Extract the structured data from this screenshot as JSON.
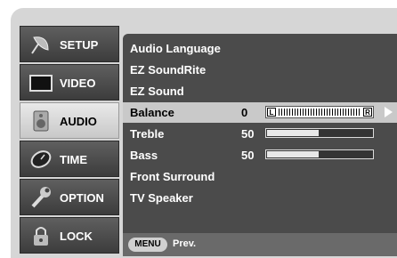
{
  "nav": [
    {
      "label": "SETUP",
      "icon": "satellite-dish-icon"
    },
    {
      "label": "VIDEO",
      "icon": "monitor-icon"
    },
    {
      "label": "AUDIO",
      "icon": "speaker-icon",
      "active": true
    },
    {
      "label": "TIME",
      "icon": "clock-icon"
    },
    {
      "label": "OPTION",
      "icon": "wrench-icon"
    },
    {
      "label": "LOCK",
      "icon": "padlock-icon"
    }
  ],
  "menu": {
    "items": [
      {
        "label": "Audio Language"
      },
      {
        "label": "EZ SoundRite"
      },
      {
        "label": "EZ Sound"
      },
      {
        "label": "Balance",
        "value": "0",
        "control": "balance",
        "selected": true,
        "left_label": "L",
        "right_label": "R"
      },
      {
        "label": "Treble",
        "value": "50",
        "control": "slider",
        "level_percent": 50
      },
      {
        "label": "Bass",
        "value": "50",
        "control": "slider",
        "level_percent": 50
      },
      {
        "label": "Front Surround"
      },
      {
        "label": "TV Speaker"
      }
    ]
  },
  "footer": {
    "menu_button": "MENU",
    "prev_label": "Prev."
  }
}
